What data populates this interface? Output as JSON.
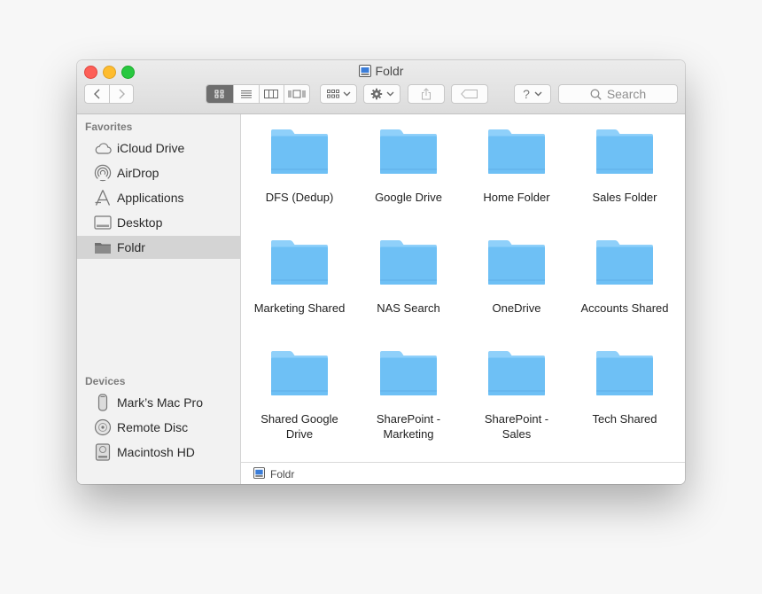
{
  "window": {
    "title": "Foldr"
  },
  "toolbar": {
    "search_placeholder": "Search",
    "help_label": "?"
  },
  "sidebar": {
    "favorites_header": "Favorites",
    "favorites": [
      {
        "label": "iCloud Drive",
        "icon": "cloud-icon"
      },
      {
        "label": "AirDrop",
        "icon": "airdrop-icon"
      },
      {
        "label": "Applications",
        "icon": "applications-icon"
      },
      {
        "label": "Desktop",
        "icon": "desktop-icon"
      },
      {
        "label": "Foldr",
        "icon": "folder-icon",
        "selected": true
      }
    ],
    "devices_header": "Devices",
    "devices": [
      {
        "label": "Mark’s Mac Pro",
        "icon": "mac-pro-icon"
      },
      {
        "label": "Remote Disc",
        "icon": "disc-icon"
      },
      {
        "label": "Macintosh HD",
        "icon": "hard-drive-icon"
      }
    ]
  },
  "folders": [
    "DFS (Dedup)",
    "Google Drive",
    "Home Folder",
    "Sales Folder",
    "Marketing  Shared",
    "NAS Search",
    "OneDrive",
    "Accounts Shared",
    "Shared Google\nDrive",
    "SharePoint -\nMarketing",
    "SharePoint -\nSales",
    "Tech Shared"
  ],
  "pathbar": {
    "label": "Foldr"
  },
  "colors": {
    "folder_top": "#8fd0fa",
    "folder_body": "#6ec0f5",
    "selection": "#d4d4d4",
    "close": "#fd5f57",
    "minimize": "#febc2e",
    "maximize": "#28c840"
  }
}
